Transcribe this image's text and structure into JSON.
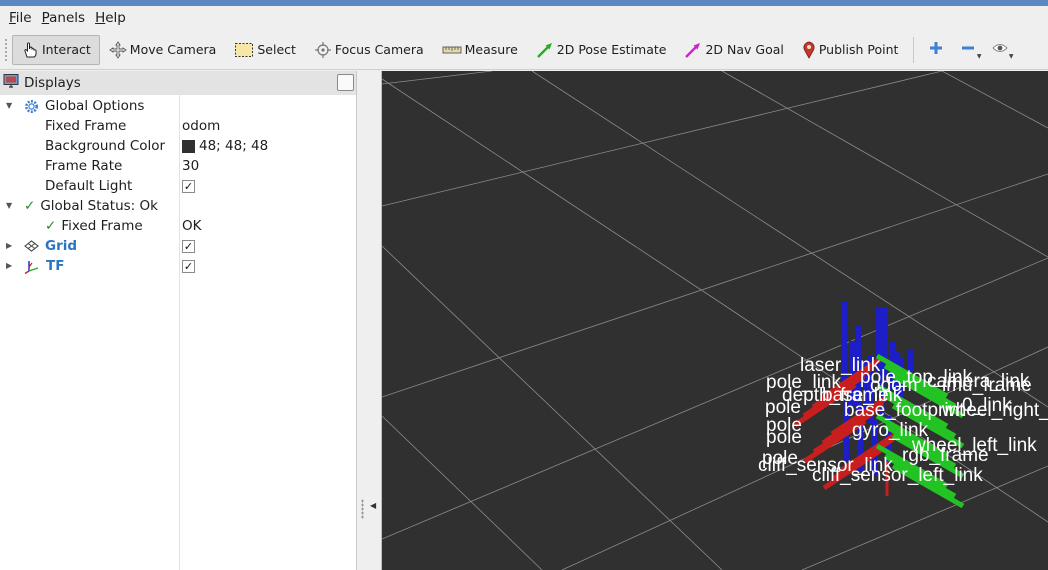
{
  "menubar": {
    "items": [
      {
        "key": "F",
        "rest": "ile"
      },
      {
        "key": "P",
        "rest": "anels"
      },
      {
        "key": "H",
        "rest": "elp"
      }
    ]
  },
  "toolbar": {
    "interact": "Interact",
    "move_camera": "Move Camera",
    "select": "Select",
    "focus_camera": "Focus Camera",
    "measure": "Measure",
    "pose_estimate": "2D Pose Estimate",
    "nav_goal": "2D Nav Goal",
    "publish_point": "Publish Point"
  },
  "displays_panel": {
    "title": "Displays",
    "global_options": {
      "label": "Global Options",
      "fixed_frame_label": "Fixed Frame",
      "fixed_frame_value": "odom",
      "background_color_label": "Background Color",
      "background_color_value": "48; 48; 48",
      "frame_rate_label": "Frame Rate",
      "frame_rate_value": "30",
      "default_light_label": "Default Light",
      "default_light_checked": true
    },
    "global_status": {
      "label": "Global Status: Ok",
      "fixed_frame_label": "Fixed Frame",
      "fixed_frame_value": "OK"
    },
    "displays": [
      {
        "name": "Grid",
        "enabled": true
      },
      {
        "name": "TF",
        "enabled": true
      }
    ]
  },
  "viewport": {
    "background": "#303030",
    "frame_labels": [
      "laser_link",
      "pole_link",
      "pole_top_link",
      "pole",
      "pole",
      "pole",
      "pole",
      "base_link",
      "base_footprint",
      "odom",
      "camera_link",
      "cliff_sensor_link",
      "cliff_sensor_left_link",
      "wheel_left_link",
      "wheel_right_link",
      "gyro_link",
      "imu_frame",
      "depth_frame",
      "rgb_frame",
      "0_link"
    ]
  },
  "colors": {
    "accent_blue": "#2b73c4",
    "ok_green": "#2a8a2a",
    "grid_line": "#a0a0a0",
    "axis_x": "#c81e1e",
    "axis_y": "#22c322",
    "axis_z": "#1e1ec8"
  }
}
